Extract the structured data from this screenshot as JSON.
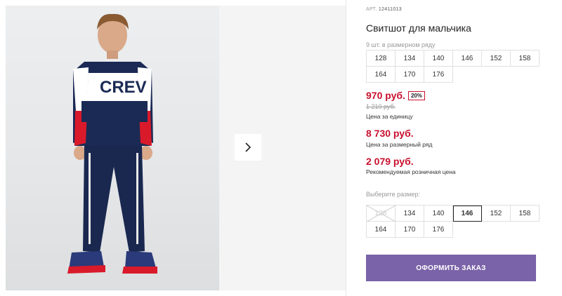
{
  "gallery": {
    "photo_text": "CREV",
    "next_icon": "chevron-right-icon"
  },
  "product": {
    "sku_label": "АРТ.",
    "sku_value": "12411013",
    "title": "Свитшот для мальчика",
    "sizes_in_row": "9 шт. в размерном ряду",
    "size_row": [
      "128",
      "134",
      "140",
      "146",
      "152",
      "158",
      "164",
      "170",
      "176"
    ],
    "price": "970 руб.",
    "discount": "20%",
    "old_price": "1 210 руб.",
    "unit_price_label": "Цена за единицу",
    "row_price": "8 730 руб.",
    "row_price_label": "Цена за размерный ряд",
    "retail_price": "2 079 руб.",
    "retail_price_label": "Рекомендуемая розничная цена",
    "choose_size_label": "Выберите размер:",
    "size_choices": [
      {
        "label": "128",
        "state": "disabled"
      },
      {
        "label": "134",
        "state": "normal"
      },
      {
        "label": "140",
        "state": "normal"
      },
      {
        "label": "146",
        "state": "selected"
      },
      {
        "label": "152",
        "state": "normal"
      },
      {
        "label": "158",
        "state": "normal"
      },
      {
        "label": "164",
        "state": "normal"
      },
      {
        "label": "170",
        "state": "normal"
      },
      {
        "label": "176",
        "state": "normal"
      }
    ],
    "order_button": "ОФОРМИТЬ ЗАКАЗ"
  },
  "colors": {
    "accent_red": "#c8102e",
    "button_purple": "#7a63a8"
  }
}
